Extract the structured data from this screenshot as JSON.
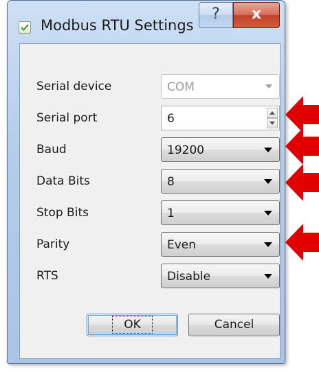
{
  "window": {
    "title": "Modbus RTU Settings",
    "help_label": "?",
    "close_label": "x"
  },
  "form": {
    "serial_device": {
      "label": "Serial device",
      "value": "COM",
      "enabled": false
    },
    "serial_port": {
      "label": "Serial port",
      "value": "6"
    },
    "baud": {
      "label": "Baud",
      "value": "19200"
    },
    "data_bits": {
      "label": "Data Bits",
      "value": "8"
    },
    "stop_bits": {
      "label": "Stop Bits",
      "value": "1"
    },
    "parity": {
      "label": "Parity",
      "value": "Even"
    },
    "rts": {
      "label": "RTS",
      "value": "Disable"
    }
  },
  "buttons": {
    "ok_label": "OK",
    "cancel_label": "Cancel"
  },
  "annotation": {
    "arrow_color": "#e00000",
    "highlighted_fields": [
      "Serial port",
      "Baud",
      "Data Bits",
      "Parity"
    ]
  }
}
